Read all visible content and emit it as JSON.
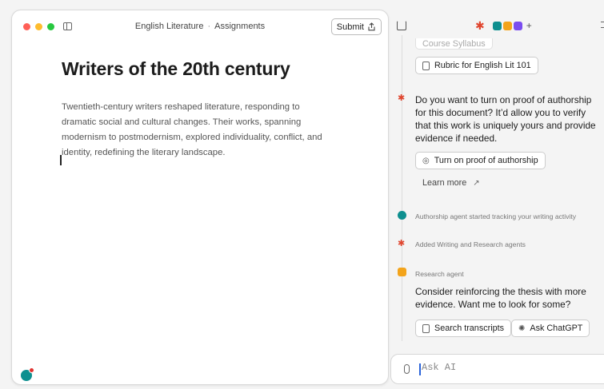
{
  "document": {
    "breadcrumb_course": "English Literature",
    "breadcrumb_separator": "·",
    "breadcrumb_section": "Assignments",
    "submit_label": "Submit",
    "title": "Writers of the 20th century",
    "body": "Twentieth-century writers reshaped literature, responding to dramatic social and cultural changes. Their works, spanning modernism to postmodernism, explored individuality, conflict, and identity, redefining the literary landscape."
  },
  "panel": {
    "attachments": [
      "Course Syllabus",
      "Rubric for English Lit 101"
    ],
    "question": "Do you want to turn on proof of authorship for this document? It’d allow you to verify that this work is uniquely yours and provide evidence if needed.",
    "turn_on_label": "Turn on proof of authorship",
    "learn_more_label": "Learn more",
    "events": [
      "Authorship agent started tracking your writing activity",
      "Added Writing and Research agents"
    ],
    "research_agent": {
      "name": "Research agent",
      "message": "Consider reinforcing the thesis with more evidence. Want me to look for some?",
      "actions": [
        "Search transcripts",
        "Ask ChatGPT"
      ]
    },
    "ask_placeholder": "Ask AI"
  },
  "colors": {
    "accent_star": "#e0452e",
    "authorship_teal": "#0e8f8f",
    "research_orange": "#f3a41b",
    "input_caret": "#2a63d9"
  },
  "icons": [
    "sidebar-toggle-icon",
    "share-icon",
    "new-chat-icon",
    "menu-icon",
    "document-icon",
    "fingerprint-icon",
    "external-link-icon",
    "search-transcripts-icon",
    "chatgpt-icon",
    "paperclip-icon"
  ]
}
